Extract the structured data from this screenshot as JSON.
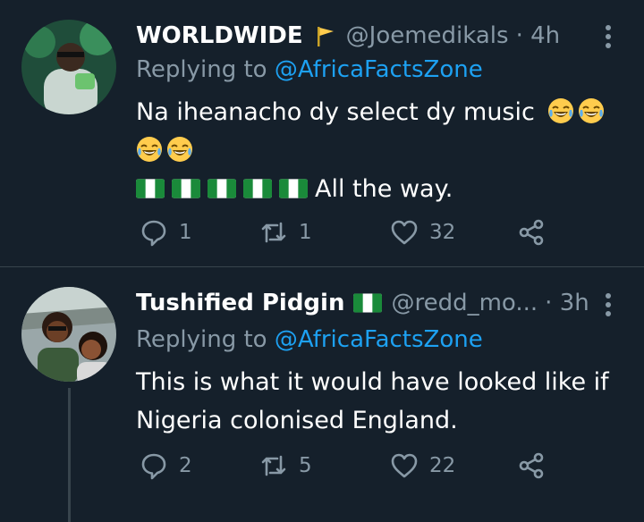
{
  "tweets": [
    {
      "name": "WORLDWIDE",
      "handle": "@Joemedikals",
      "time": "· 4h",
      "replying_prefix": "Replying to ",
      "replying_to": "@AfricaFactsZone",
      "text_line1": "Na iheanacho dy select dy music",
      "text_line3": "All the way.",
      "replies": "1",
      "retweets": "1",
      "likes": "32"
    },
    {
      "name": "Tushified Pidgin",
      "handle": "@redd_mo...",
      "time": "· 3h",
      "replying_prefix": "Replying to ",
      "replying_to": "@AfricaFactsZone",
      "text": "This is what it would have looked like if Nigeria colonised England.",
      "replies": "2",
      "retweets": "5",
      "likes": "22"
    }
  ],
  "icons": {
    "reply": "reply-icon",
    "retweet": "retweet-icon",
    "like": "heart-icon",
    "share": "share-icon",
    "more": "more-vertical-icon"
  },
  "colors": {
    "background": "#15202b",
    "secondary_text": "#8899a6",
    "link": "#1da1f2",
    "divider": "#38444d"
  }
}
